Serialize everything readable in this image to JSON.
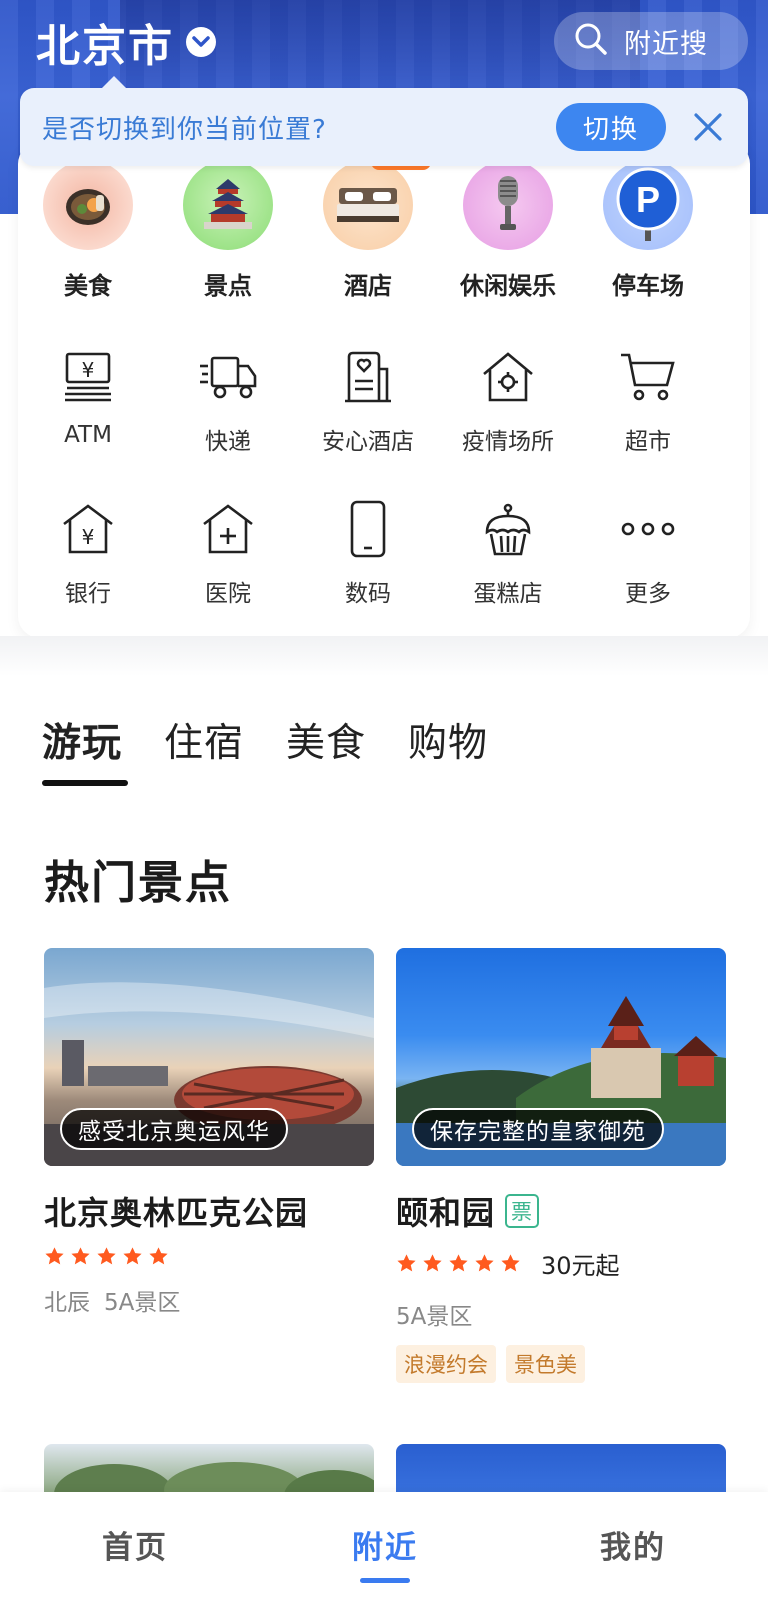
{
  "header": {
    "city": "北京市",
    "search_label": "附近搜"
  },
  "location_banner": {
    "text": "是否切换到你当前位置?",
    "switch_label": "切换"
  },
  "categories_featured": [
    {
      "label": "美食",
      "icon": "food-icon"
    },
    {
      "label": "景点",
      "icon": "temple-icon"
    },
    {
      "label": "酒店",
      "icon": "bed-icon"
    },
    {
      "label": "休闲娱乐",
      "icon": "microphone-icon"
    },
    {
      "label": "停车场",
      "icon": "parking-icon"
    }
  ],
  "categories_row2": [
    {
      "label": "ATM",
      "icon": "atm-icon"
    },
    {
      "label": "快递",
      "icon": "delivery-truck-icon"
    },
    {
      "label": "安心酒店",
      "icon": "safe-hotel-icon"
    },
    {
      "label": "疫情场所",
      "icon": "virus-house-icon"
    },
    {
      "label": "超市",
      "icon": "shopping-cart-icon"
    }
  ],
  "categories_row3": [
    {
      "label": "银行",
      "icon": "bank-icon"
    },
    {
      "label": "医院",
      "icon": "hospital-icon"
    },
    {
      "label": "数码",
      "icon": "phone-icon"
    },
    {
      "label": "蛋糕店",
      "icon": "cake-icon"
    },
    {
      "label": "更多",
      "icon": "more-icon"
    }
  ],
  "tabs": [
    "游玩",
    "住宿",
    "美食",
    "购物"
  ],
  "section_title": "热门景点",
  "cards": [
    {
      "caption": "感受北京奥运风华",
      "title": "北京奥林匹克公园",
      "rating": 5,
      "meta": [
        "北辰",
        "5A景区"
      ]
    },
    {
      "caption": "保存完整的皇家御苑",
      "title": "颐和园",
      "ticket_badge": "票",
      "rating": 5,
      "price": "30元起",
      "meta": [
        "5A景区"
      ],
      "tags": [
        "浪漫约会",
        "景色美"
      ]
    }
  ],
  "bottom_nav": [
    "首页",
    "附近",
    "我的"
  ],
  "colors": {
    "brand_blue": "#3a7bf0",
    "header_blue": "#2f56c9",
    "star_orange": "#ff5a1f",
    "ticket_green": "#3bb58e"
  }
}
